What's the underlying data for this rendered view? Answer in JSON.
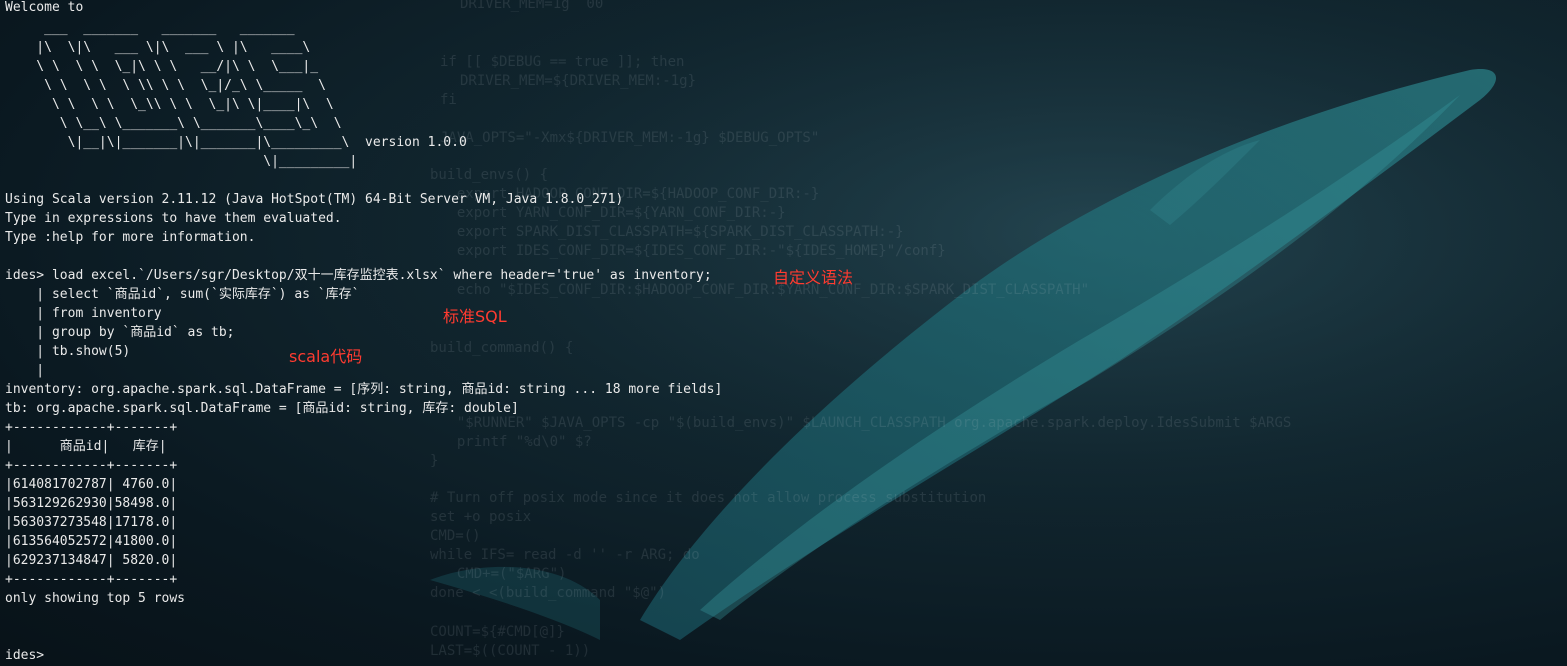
{
  "terminal": {
    "welcome": "Welcome to",
    "logo": [
      "     ___  _______   _______   _______",
      "    |\\  \\|\\   ___ \\|\\  ___ \\ |\\   ____\\",
      "    \\ \\  \\ \\  \\_|\\ \\ \\   __/|\\ \\  \\___|_",
      "     \\ \\  \\ \\  \\ \\\\ \\ \\  \\_|/_\\ \\_____  \\",
      "      \\ \\  \\ \\  \\_\\\\ \\ \\  \\_|\\ \\|____|\\  \\",
      "       \\ \\__\\ \\_______\\ \\_______\\____\\_\\  \\",
      "        \\|__|\\|_______|\\|_______|\\_________\\  version 1.0.0",
      "                                 \\|_________|"
    ],
    "banner": [
      "Using Scala version 2.11.12 (Java HotSpot(TM) 64-Bit Server VM, Java 1.8.0_271)",
      "Type in expressions to have them evaluated.",
      "Type :help for more information."
    ],
    "prompt_line": "ides> load excel.`/Users/sgr/Desktop/双十一库存监控表.xlsx` where header='true' as inventory;",
    "continuation": [
      "    | select `商品id`, sum(`实际库存`) as `库存`",
      "    | from inventory",
      "    | group by `商品id` as tb;",
      "    | tb.show(5)",
      "    |"
    ],
    "results": [
      "inventory: org.apache.spark.sql.DataFrame = [序列: string, 商品id: string ... 18 more fields]",
      "tb: org.apache.spark.sql.DataFrame = [商品id: string, 库存: double]"
    ],
    "table": {
      "border": "+------------+-------+",
      "header": "|      商品id|   库存|",
      "rows": [
        "|614081702787| 4760.0|",
        "|563129262930|58498.0|",
        "|563037273548|17178.0|",
        "|613564052572|41800.0|",
        "|629237134847| 5820.0|"
      ]
    },
    "footer": "only showing top 5 rows",
    "final_prompt": "ides>"
  },
  "annotations": {
    "custom_syntax": "自定义语法",
    "standard_sql": "标准SQL",
    "scala_code": "scala代码"
  },
  "background_text": [
    "DRIVER_MEM=1g  00",
    "if [[ $DEBUG == true ]]; then",
    "DRIVER_MEM=${DRIVER_MEM:-1g}",
    "fi",
    "JAVA_OPTS=\"-Xmx${DRIVER_MEM:-1g} $DEBUG_OPTS\"",
    "build_envs() {",
    "  export HADOOP_CONF_DIR=${HADOOP_CONF_DIR:-}",
    "  export YARN_CONF_DIR=${YARN_CONF_DIR:-}",
    "  export SPARK_DIST_CLASSPATH=${SPARK_DIST_CLASSPATH:-}",
    "  export IDES_CONF_DIR=${IDES_CONF_DIR:-\"${IDES_HOME}\"/conf}",
    "  echo \"$IDES_CONF_DIR:$HADOOP_CONF_DIR:$YARN_CONF_DIR:$SPARK_DIST_CLASSPATH\"",
    "build_command() {",
    "  \"$RUNNER\" $JAVA_OPTS -cp \"$(build_envs)\" $LAUNCH_CLASSPATH org.apache.spark.deploy.IdesSubmit $ARGS",
    "  printf \"%d\\0\" $?",
    "}",
    "# Turn off posix mode since it does not allow process substitution",
    "set +o posix",
    "CMD=()",
    "while IFS= read -d '' -r ARG; do",
    "  CMD+=(\"$ARG\")",
    "done < <(build_command \"$@\")",
    "COUNT=${#CMD[@]}",
    "LAST=$((COUNT - 1))"
  ]
}
